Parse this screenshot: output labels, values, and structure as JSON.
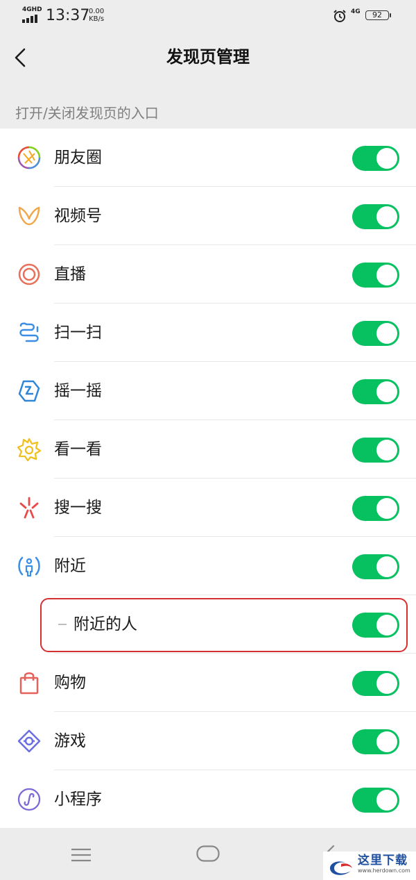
{
  "status_bar": {
    "network": "4GHD",
    "time": "13:37",
    "speed_value": "0.00",
    "speed_unit": "KB/s",
    "cell": "4G",
    "battery": "92",
    "icons": [
      "signal-bars-icon",
      "alarm-icon",
      "battery-icon"
    ]
  },
  "header": {
    "title": "发现页管理",
    "back_icon": "chevron-left-icon"
  },
  "section": {
    "label": "打开/关闭发现页的入口"
  },
  "items": [
    {
      "label": "朋友圈",
      "icon": "moments-aperture-icon",
      "enabled": true
    },
    {
      "label": "视频号",
      "icon": "channels-butterfly-icon",
      "enabled": true
    },
    {
      "label": "直播",
      "icon": "live-ring-icon",
      "enabled": true
    },
    {
      "label": "扫一扫",
      "icon": "scan-icon",
      "enabled": true
    },
    {
      "label": "摇一摇",
      "icon": "shake-icon",
      "enabled": true
    },
    {
      "label": "看一看",
      "icon": "top-stories-star-icon",
      "enabled": true
    },
    {
      "label": "搜一搜",
      "icon": "search-spark-icon",
      "enabled": true
    },
    {
      "label": "附近",
      "icon": "nearby-person-icon",
      "enabled": true
    },
    {
      "label": "附近的人",
      "icon": "",
      "enabled": true,
      "sub": true,
      "highlighted": true
    },
    {
      "label": "购物",
      "icon": "shopping-bag-icon",
      "enabled": true
    },
    {
      "label": "游戏",
      "icon": "game-diamond-icon",
      "enabled": true
    },
    {
      "label": "小程序",
      "icon": "mini-program-icon",
      "enabled": true
    }
  ],
  "colors": {
    "toggle_on": "#07c160",
    "highlight": "#d43030",
    "background": "#ededed"
  },
  "nav_bar": {
    "icons": [
      "menu-lines-icon",
      "home-pill-icon",
      "back-chevron-icon"
    ]
  },
  "watermark": {
    "title": "这里下载",
    "url": "www.herdown.com"
  }
}
